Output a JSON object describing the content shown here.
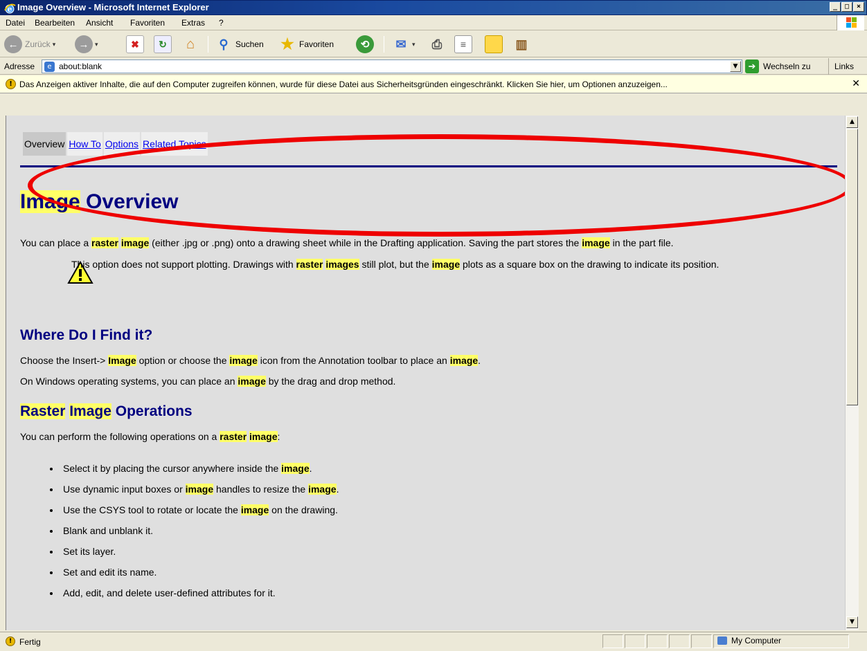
{
  "window": {
    "title": "Image Overview - Microsoft Internet Explorer",
    "controls": {
      "minimize": "_",
      "maximize": "□",
      "close": "×"
    }
  },
  "menu": {
    "items": [
      "Datei",
      "Bearbeiten",
      "Ansicht",
      "Favoriten",
      "Extras",
      "?"
    ]
  },
  "toolbar": {
    "back_label": "Zurück",
    "search_label": "Suchen",
    "favorites_label": "Favoriten"
  },
  "address": {
    "label": "Adresse",
    "url": "about:blank",
    "go_label": "Wechseln zu",
    "links_label": "Links"
  },
  "infobar": {
    "message": "Das Anzeigen aktiver Inhalte, die auf den Computer zugreifen können, wurde für diese Datei aus Sicherheitsgründen eingeschränkt. Klicken Sie hier, um Optionen anzuzeigen..."
  },
  "page": {
    "tabs": [
      "Overview",
      "How To",
      "Options",
      "Related Topics"
    ],
    "title_highlight": "Image",
    "title_rest": " Overview",
    "intro": {
      "t1": "You can place a ",
      "h1": "raster",
      "t2": " ",
      "h2": "image",
      "t3": " (either .jpg or .png) onto a drawing sheet while in the Drafting application. Saving the part stores the ",
      "h3": "image",
      "t4": " in the part file."
    },
    "note": {
      "t1": "This option does not support plotting. Drawings with ",
      "h1": "raster",
      "t2": " ",
      "h2": "images",
      "t3": " still plot, but the ",
      "h3": "image",
      "t4": " plots as a square box on the drawing to indicate its position."
    },
    "where_heading": "Where Do I Find it?",
    "where_p1": {
      "t1": "Choose the Insert-> ",
      "h1": "Image",
      "t2": " option or choose the ",
      "h2": "image",
      "t3": " icon from the Annotation toolbar to place an ",
      "h3": "image",
      "t4": "."
    },
    "where_p2": {
      "t1": "On Windows operating systems, you can place an ",
      "h1": "image",
      "t2": " by the drag and drop method."
    },
    "ops_heading": {
      "h1": "Raster",
      "t1": " ",
      "h2": "Image",
      "t2": " Operations"
    },
    "ops_intro": {
      "t1": "You can perform the following operations on a ",
      "h1": "raster",
      "t2": " ",
      "h2": "image",
      "t3": ":"
    },
    "ops": [
      {
        "t1": "Select it by placing the cursor anywhere inside the ",
        "h1": "image",
        "t2": "."
      },
      {
        "t1": "Use dynamic input boxes or ",
        "h1": "image",
        "t2": " handles to resize the ",
        "h2": "image",
        "t3": "."
      },
      {
        "t1": "Use the CSYS tool to rotate or locate the ",
        "h1": "image",
        "t2": " on the drawing."
      },
      {
        "t1": "Blank and unblank it."
      },
      {
        "t1": "Set its layer."
      },
      {
        "t1": "Set and edit its name."
      },
      {
        "t1": "Add, edit, and delete user-defined attributes for it."
      }
    ]
  },
  "status": {
    "text": "Fertig",
    "zone": "My Computer"
  },
  "colors": {
    "highlight": "#ffff66",
    "heading": "#000080",
    "annotation_ellipse": "#ee0000"
  }
}
